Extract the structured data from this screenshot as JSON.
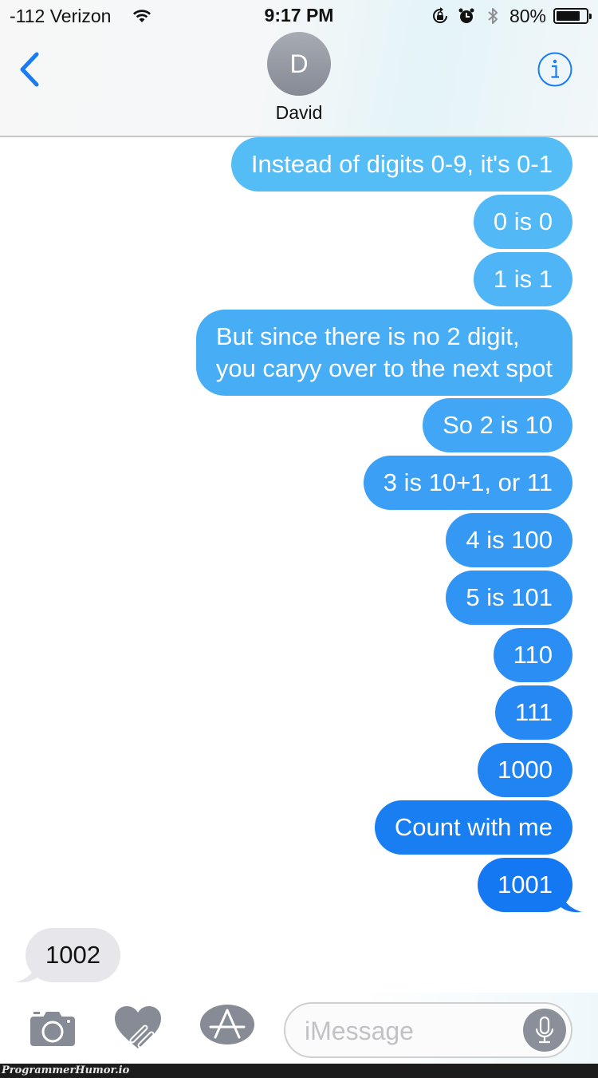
{
  "status_bar": {
    "carrier": "-112 Verizon",
    "time": "9:17 PM",
    "battery_percent": "80%",
    "battery_level": 0.8,
    "icons": [
      "wifi-icon",
      "rotation-lock-icon",
      "alarm-icon",
      "bluetooth-icon",
      "battery-icon"
    ]
  },
  "header": {
    "back_icon": "chevron-left-icon",
    "avatar_initial": "D",
    "contact_name": "David",
    "info_icon": "info-icon",
    "accent_color": "#1a7cf2"
  },
  "messages": [
    {
      "direction": "outgoing",
      "text": "Instead of digits 0-9, it's 0-1",
      "color": "#55bdf6"
    },
    {
      "direction": "outgoing",
      "text": "0 is 0",
      "color": "#52b9f6"
    },
    {
      "direction": "outgoing",
      "text": "1 is 1",
      "color": "#4fb5f6"
    },
    {
      "direction": "outgoing",
      "text": "But since there is no 2 digit,\nyou caryy over to the next spot",
      "color": "#47adf5"
    },
    {
      "direction": "outgoing",
      "text": "So 2 is 10",
      "color": "#41a6f5"
    },
    {
      "direction": "outgoing",
      "text": "3 is 10+1, or 11",
      "color": "#3b9ff5"
    },
    {
      "direction": "outgoing",
      "text": "4 is 100",
      "color": "#3599f4"
    },
    {
      "direction": "outgoing",
      "text": "5 is 101",
      "color": "#3094f4"
    },
    {
      "direction": "outgoing",
      "text": "110",
      "color": "#2b8ef4"
    },
    {
      "direction": "outgoing",
      "text": "111",
      "color": "#2689f3"
    },
    {
      "direction": "outgoing",
      "text": "1000",
      "color": "#2084f3"
    },
    {
      "direction": "outgoing",
      "text": "Count with me",
      "color": "#1a7ef3"
    },
    {
      "direction": "outgoing",
      "text": "1001",
      "color": "#1478f2"
    },
    {
      "direction": "incoming",
      "text": "1002",
      "color": "#e6e6eb"
    }
  ],
  "compose": {
    "camera_icon": "camera-icon",
    "digital_touch_icon": "heart-touch-icon",
    "app_store_icon": "app-store-icon",
    "placeholder": "iMessage",
    "value": "",
    "mic_icon": "microphone-icon"
  },
  "watermark": "ProgrammerHumor.io"
}
